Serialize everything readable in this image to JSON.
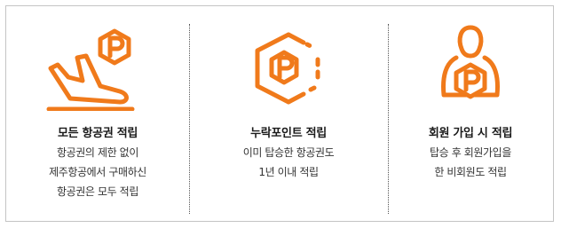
{
  "colors": {
    "accent": "#f07a1b",
    "border": "#c4c4c4",
    "text": "#1a1a1a"
  },
  "features": [
    {
      "icon": "plane-landing-parking-icon",
      "title": "모든 항공권 적립",
      "lines": [
        "항공권의 제한 없이",
        "제주항공에서 구매하신",
        "항공권은 모두 적립"
      ]
    },
    {
      "icon": "missing-points-hexagon-icon",
      "title": "누락포인트 적립",
      "lines": [
        "이미 탑승한 항공권도",
        "1년 이내 적립"
      ]
    },
    {
      "icon": "member-join-points-icon",
      "title": "회원 가입 시 적립",
      "lines": [
        "탑승 후 회원가입을",
        "한 비회원도 적립"
      ]
    }
  ]
}
